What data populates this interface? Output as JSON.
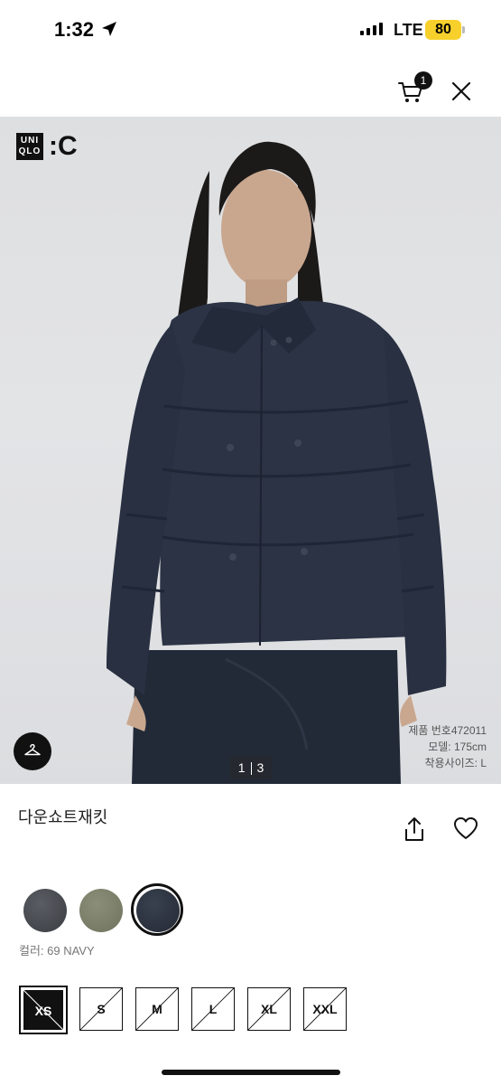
{
  "status_bar": {
    "time": "1:32",
    "network": "LTE",
    "battery": "80",
    "battery_color": "#f7d02c"
  },
  "header": {
    "cart_count": "1",
    "icons": [
      "cart-icon",
      "close-icon"
    ]
  },
  "hero": {
    "logo": {
      "box_line1": "UNI",
      "box_line2": "QLO",
      "suffix": "C"
    },
    "counter": {
      "current": "1",
      "total": "3"
    },
    "meta": {
      "product_no": "제품 번호472011",
      "model": "모델: 175cm",
      "wearing_size": "착용사이즈: L"
    },
    "icons": [
      "hanger-icon"
    ]
  },
  "product": {
    "name": "다운쇼트재킷",
    "icons": [
      "share-icon",
      "heart-icon"
    ]
  },
  "colors": {
    "label": "컬러: 69 NAVY",
    "swatches": [
      {
        "name": "dark-gray",
        "hex": "#4a4d52"
      },
      {
        "name": "olive",
        "hex": "#7f8269"
      },
      {
        "name": "navy",
        "hex": "#2e3542",
        "selected": true
      }
    ]
  },
  "sizes": {
    "options": [
      {
        "label": "XS",
        "selected": true,
        "unavailable": true
      },
      {
        "label": "S",
        "unavailable": true
      },
      {
        "label": "M",
        "unavailable": true
      },
      {
        "label": "L",
        "unavailable": true
      },
      {
        "label": "XL",
        "unavailable": true
      },
      {
        "label": "XXL",
        "unavailable": true
      }
    ]
  }
}
